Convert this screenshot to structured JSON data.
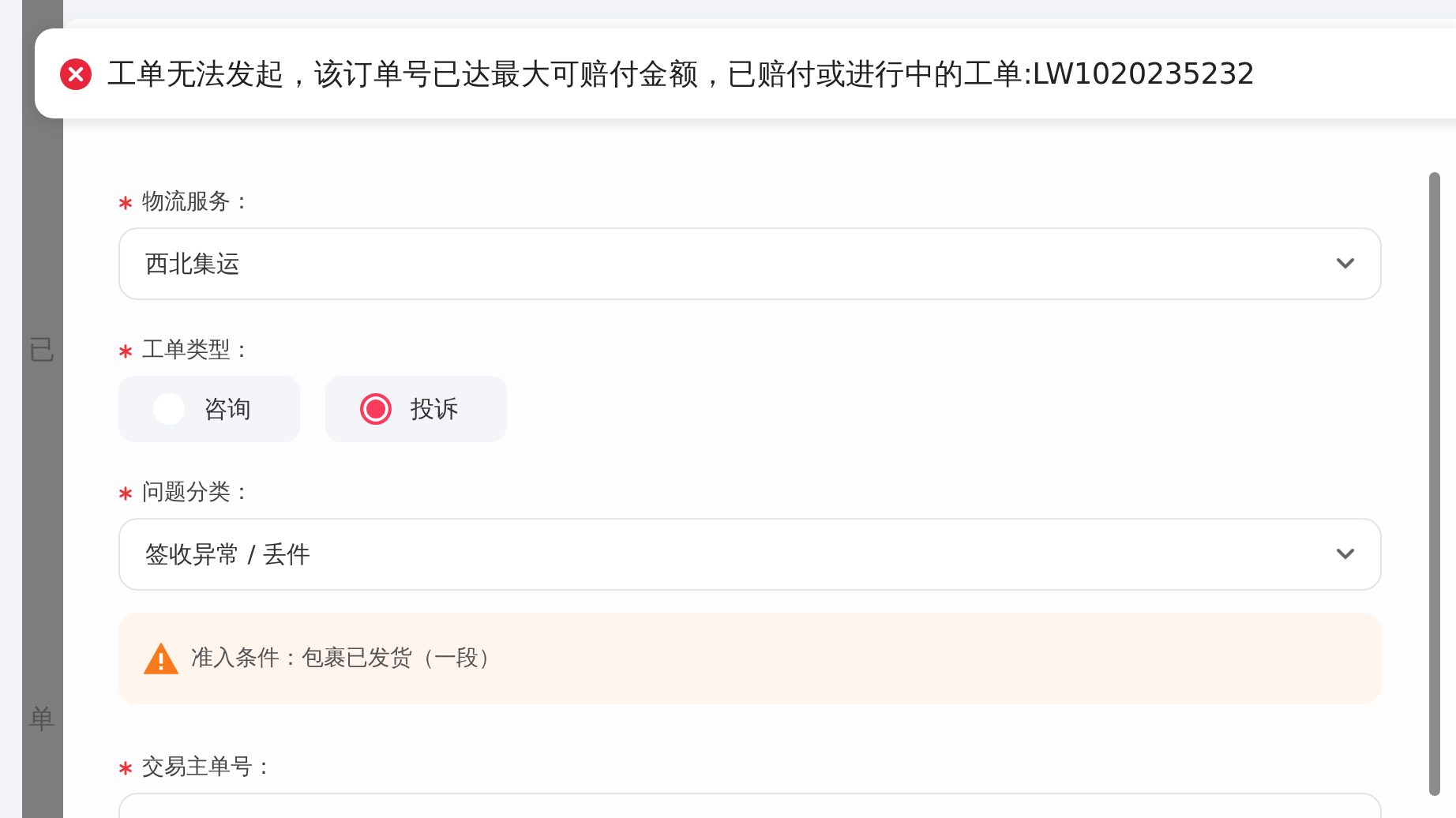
{
  "toast": {
    "kind": "error",
    "message": "工单无法发起，该订单号已达最大可赔付金额，已赔付或进行中的工单:LW1020235232"
  },
  "background": {
    "fragments": [
      "已",
      "单"
    ]
  },
  "form": {
    "fields": [
      {
        "kind": "select",
        "label": "物流服务：",
        "required": true,
        "value": "西北集运"
      },
      {
        "kind": "radio",
        "label": "工单类型：",
        "required": true,
        "options": [
          {
            "label": "咨询",
            "selected": false
          },
          {
            "label": "投诉",
            "selected": true
          }
        ]
      },
      {
        "kind": "select",
        "label": "问题分类：",
        "required": true,
        "value": "签收异常 / 丢件"
      },
      {
        "kind": "warning",
        "text": "准入条件：包裹已发货（一段）"
      },
      {
        "kind": "input",
        "label": "交易主单号：",
        "required": true
      }
    ]
  }
}
